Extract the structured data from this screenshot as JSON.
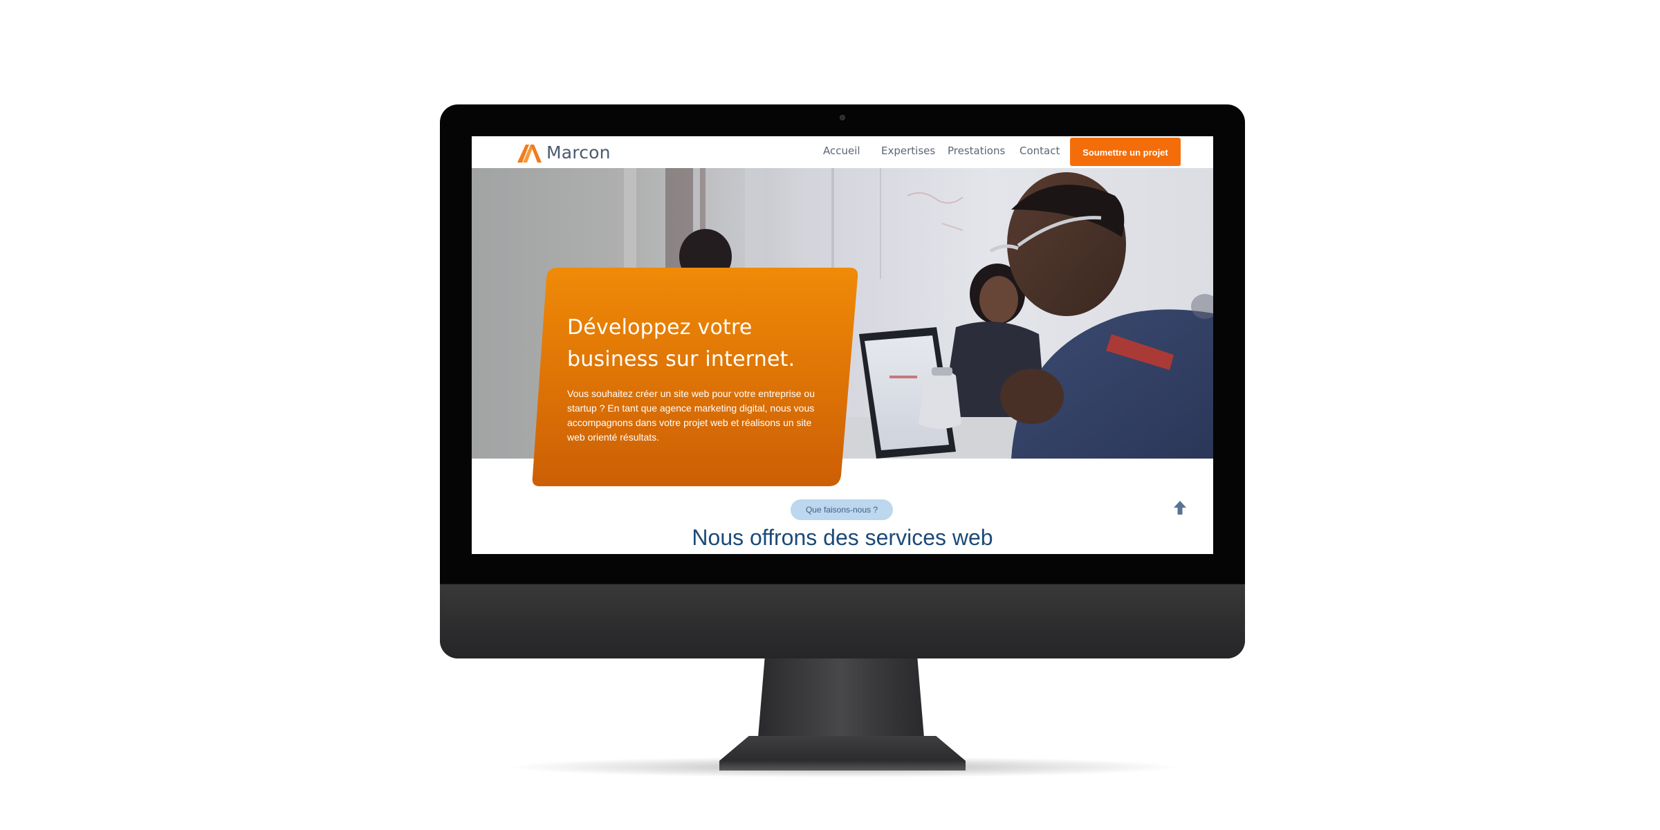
{
  "site": {
    "brand": "Marcon",
    "colors": {
      "accent": "#f36d0a",
      "brand_text": "#4a5a6e",
      "heading_blue": "#1b4a78",
      "pill_bg": "#bcd7ee"
    }
  },
  "nav": {
    "items": [
      {
        "label": "Accueil"
      },
      {
        "label": "Expertises"
      },
      {
        "label": "Prestations"
      },
      {
        "label": "Contact"
      }
    ],
    "cta_label": "Soumettre un projet"
  },
  "hero": {
    "title_line1": "Développez votre",
    "title_line2": "business sur internet.",
    "text": "Vous souhaitez créer un site web pour votre entreprise ou startup ? En tant que agence marketing digital, nous vous accompagnons dans votre projet web et réalisons un site web orienté résultats."
  },
  "services": {
    "badge": "Que faisons-nous ?",
    "title": "Nous offrons des services web"
  },
  "icons": {
    "logo": "marcon-m-logo-icon",
    "scroll_top": "arrow-up-icon",
    "camera": "camera-icon"
  }
}
